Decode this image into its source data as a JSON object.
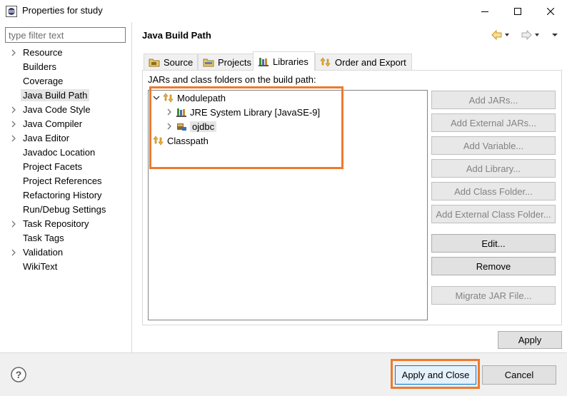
{
  "window": {
    "title": "Properties for study"
  },
  "filter": {
    "placeholder": "type filter text"
  },
  "nav": {
    "items": [
      {
        "label": "Resource",
        "expandable": true
      },
      {
        "label": "Builders",
        "expandable": false
      },
      {
        "label": "Coverage",
        "expandable": false
      },
      {
        "label": "Java Build Path",
        "expandable": false,
        "selected": true
      },
      {
        "label": "Java Code Style",
        "expandable": true
      },
      {
        "label": "Java Compiler",
        "expandable": true
      },
      {
        "label": "Java Editor",
        "expandable": true
      },
      {
        "label": "Javadoc Location",
        "expandable": false
      },
      {
        "label": "Project Facets",
        "expandable": false
      },
      {
        "label": "Project References",
        "expandable": false
      },
      {
        "label": "Refactoring History",
        "expandable": false
      },
      {
        "label": "Run/Debug Settings",
        "expandable": false
      },
      {
        "label": "Task Repository",
        "expandable": true
      },
      {
        "label": "Task Tags",
        "expandable": false
      },
      {
        "label": "Validation",
        "expandable": true
      },
      {
        "label": "WikiText",
        "expandable": false
      }
    ]
  },
  "page": {
    "title": "Java Build Path"
  },
  "tabs": {
    "source": "Source",
    "projects": "Projects",
    "libraries": "Libraries",
    "order": "Order and Export",
    "active": "Libraries"
  },
  "libraries": {
    "path_label": "JARs and class folders on the build path:",
    "modulepath": "Modulepath",
    "jre": "JRE System Library [JavaSE-9]",
    "ojdbc": "ojdbc",
    "classpath": "Classpath"
  },
  "buttons": {
    "add_jars": "Add JARs...",
    "add_external_jars": "Add External JARs...",
    "add_variable": "Add Variable...",
    "add_library": "Add Library...",
    "add_class_folder": "Add Class Folder...",
    "add_external_class_folder": "Add External Class Folder...",
    "edit": "Edit...",
    "remove": "Remove",
    "migrate": "Migrate JAR File...",
    "apply": "Apply",
    "apply_and_close": "Apply and Close",
    "cancel": "Cancel"
  },
  "colors": {
    "highlight": "#ee7a2b",
    "selection": "#e5e5e5",
    "default_button_border": "#0078d7"
  }
}
